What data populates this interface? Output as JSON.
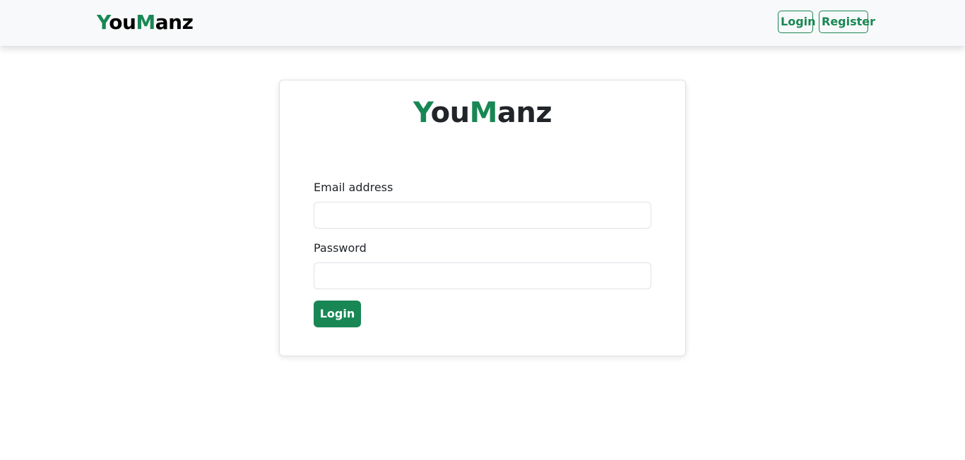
{
  "navbar": {
    "brand": {
      "part1_accent": "Y",
      "part2": "ou",
      "part3_accent": "M",
      "part4": "anz"
    },
    "login_label": "Login",
    "register_label": "Register"
  },
  "card": {
    "title": {
      "part1_accent": "Y",
      "part2": "ou",
      "part3_accent": "M",
      "part4": "anz"
    },
    "email_label": "Email address",
    "email_value": "",
    "password_label": "Password",
    "password_value": "",
    "submit_label": "Login"
  },
  "colors": {
    "accent": "#198754",
    "navbar_bg": "#f8f9fa",
    "text": "#212529",
    "border": "#dee2e6"
  }
}
